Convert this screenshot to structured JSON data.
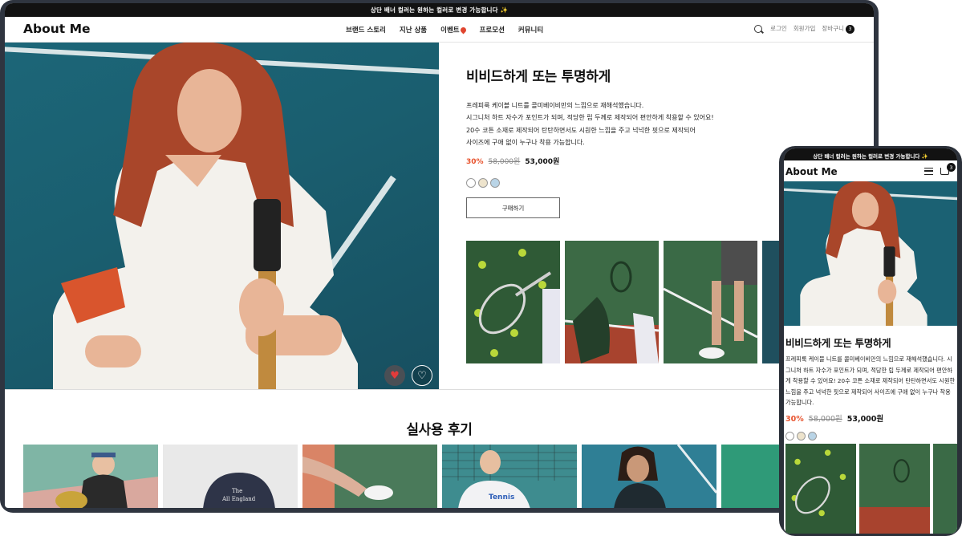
{
  "banner": "상단 배너 컬러는 원하는 컬러로 변경 가능합니다 ✨",
  "logo": "About Me",
  "nav": [
    "브랜드 스토리",
    "지난 상품",
    "이벤트",
    "프로모션",
    "커뮤니티"
  ],
  "header_right": {
    "login": "로그인",
    "signup": "회원가입",
    "cart": "장바구니",
    "cart_count": "3"
  },
  "product": {
    "title": "비비드하게 또는 투명하게",
    "description": [
      "프레피룩 케이블 니트를 콜미베이비만의 느낌으로 재해석했습니다.",
      "시그니처 하트 자수가 포인트가 되며, 적당한 립 두께로 제작되어 편안하게 착용할 수 있어요!",
      "20수 코튼 소재로 제작되어 탄탄하면서도 시원한 느낌을 주고 넉넉한 핏으로 제작되어",
      "사이즈에 구애 없이 누구나 착용 가능합니다."
    ],
    "mobile_description": "프레피룩 케이블 니트를 콜미베이비만의 느낌으로 재해석했습니다. 시그니처 하트 자수가 포인트가 되며, 적당한 립 두께로 제작되어 편안하게 착용할 수 있어요! 20수 코튼 소재로 제작되어 탄탄하면서도 시원한 느낌을 주고 넉넉한 핏으로 제작되어 사이즈에 구애 없이 누구나 착용 가능합니다.",
    "discount": "30%",
    "original_price": "58,000원",
    "price": "53,000원",
    "swatch_colors": [
      "#ffffff",
      "#ede3cc",
      "#b9d4e6"
    ],
    "buy_label": "구매하기"
  },
  "reviews_title": "실사용 후기",
  "colors": {
    "accent": "#e8542f",
    "banner": "#121212",
    "device": "#2f3540"
  },
  "icons": {
    "search": "search-icon",
    "heart_filled": "heart-filled-icon",
    "heart_outline": "heart-outline-icon",
    "menu": "menu-icon",
    "cart": "cart-icon"
  }
}
